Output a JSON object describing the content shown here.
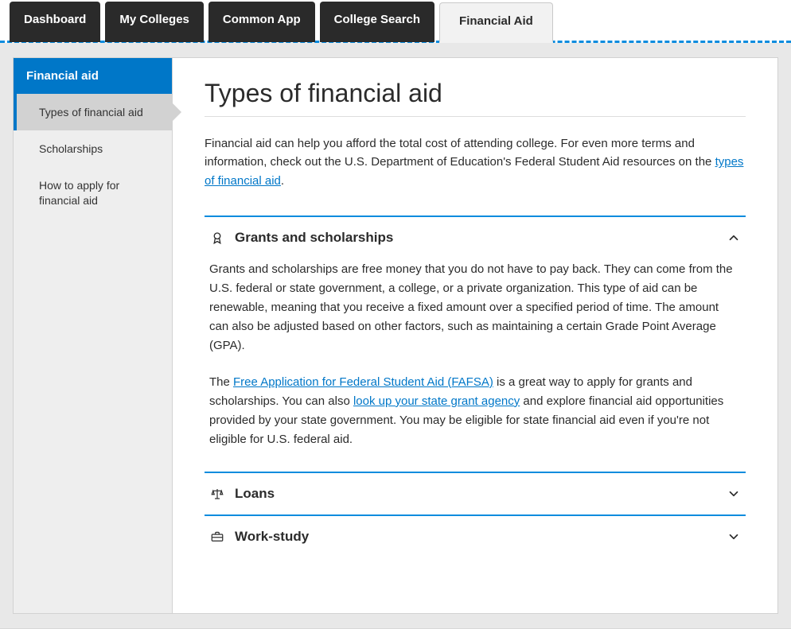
{
  "tabs": {
    "items": [
      {
        "label": "Dashboard"
      },
      {
        "label": "My Colleges"
      },
      {
        "label": "Common App"
      },
      {
        "label": "College Search"
      },
      {
        "label": "Financial Aid"
      }
    ],
    "activeIndex": 4
  },
  "sidebar": {
    "header": "Financial aid",
    "items": [
      {
        "label": "Types of financial aid"
      },
      {
        "label": "Scholarships"
      },
      {
        "label": "How to apply for financial aid"
      }
    ],
    "activeIndex": 0
  },
  "main": {
    "title": "Types of financial aid",
    "intro": {
      "pre": "Financial aid can help you afford the total cost of attending college. For even more terms and information, check out the U.S. Department of Education's Federal Student Aid resources on the ",
      "linkText": "types of financial aid",
      "post": "."
    },
    "sections": {
      "grants": {
        "label": "Grants and scholarships",
        "expanded": true,
        "body1": "Grants and scholarships are free money that you do not have to pay back. They can come from the U.S. federal or state government, a college, or a private organization. This type of aid can be renewable, meaning that you receive a fixed amount over a specified period of time. The amount can also be adjusted based on other factors, such as maintaining a certain Grade Point Average (GPA).",
        "body2_pre": "The ",
        "body2_link1": "Free Application for Federal Student Aid (FAFSA)",
        "body2_mid": " is a great way to apply for grants and scholarships. You can also ",
        "body2_link2": "look up your state grant agency",
        "body2_post": " and explore financial aid opportunities provided by your state government. You may be eligible for state financial aid even if you're not eligible for U.S. federal aid."
      },
      "loans": {
        "label": "Loans",
        "expanded": false
      },
      "work": {
        "label": "Work-study",
        "expanded": false
      }
    }
  }
}
